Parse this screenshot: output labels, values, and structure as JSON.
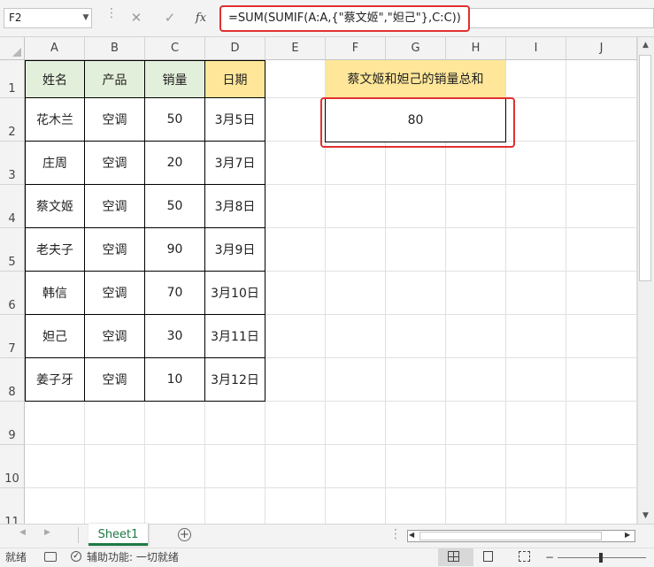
{
  "formula_bar": {
    "name_box": "F2",
    "cancel_glyph": "✕",
    "enter_glyph": "✓",
    "fx_label": "fx",
    "formula": "=SUM(SUMIF(A:A,{\"蔡文姬\",\"妲己\"},C:C))"
  },
  "columns": [
    "A",
    "B",
    "C",
    "D",
    "E",
    "F",
    "G",
    "H",
    "I",
    "J"
  ],
  "rows": [
    "1",
    "2",
    "3",
    "4",
    "5",
    "6",
    "7",
    "8",
    "9",
    "10",
    "11"
  ],
  "table": {
    "headers": [
      "姓名",
      "产品",
      "销量",
      "日期"
    ],
    "rows": [
      [
        "花木兰",
        "空调",
        "50",
        "3月5日"
      ],
      [
        "庄周",
        "空调",
        "20",
        "3月7日"
      ],
      [
        "蔡文姬",
        "空调",
        "50",
        "3月8日"
      ],
      [
        "老夫子",
        "空调",
        "90",
        "3月9日"
      ],
      [
        "韩信",
        "空调",
        "70",
        "3月10日"
      ],
      [
        "妲己",
        "空调",
        "30",
        "3月11日"
      ],
      [
        "姜子牙",
        "空调",
        "10",
        "3月12日"
      ]
    ]
  },
  "summary": {
    "header": "蔡文姬和妲己的销量总和",
    "value": "80"
  },
  "sheet_tab": "Sheet1",
  "status": {
    "ready": "就绪",
    "accessibility": "辅助功能: 一切就绪"
  },
  "colors": {
    "header_green": "#e2efda",
    "header_yellow": "#ffe699",
    "highlight_red": "#e03030",
    "excel_green": "#1d7a44"
  }
}
